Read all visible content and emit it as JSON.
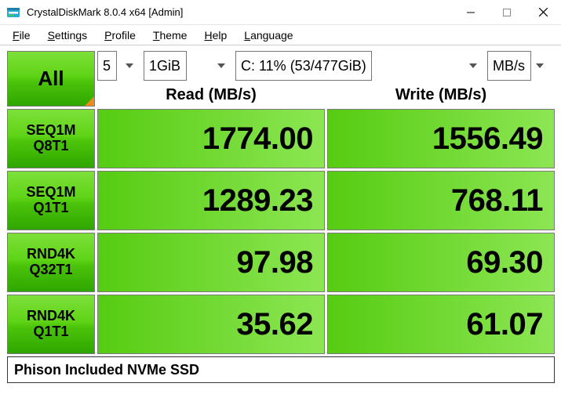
{
  "window": {
    "title": "CrystalDiskMark 8.0.4 x64 [Admin]"
  },
  "menu": {
    "file": "File",
    "settings": "Settings",
    "profile": "Profile",
    "theme": "Theme",
    "help": "Help",
    "language": "Language"
  },
  "controls": {
    "all_label": "All",
    "runs": "5",
    "size": "1GiB",
    "drive": "C: 11% (53/477GiB)",
    "unit": "MB/s"
  },
  "headers": {
    "read": "Read (MB/s)",
    "write": "Write (MB/s)"
  },
  "tests": [
    {
      "id": "seq1m-q8t1",
      "line1": "SEQ1M",
      "line2": "Q8T1",
      "read": "1774.00",
      "write": "1556.49"
    },
    {
      "id": "seq1m-q1t1",
      "line1": "SEQ1M",
      "line2": "Q1T1",
      "read": "1289.23",
      "write": "768.11"
    },
    {
      "id": "rnd4k-q32t1",
      "line1": "RND4K",
      "line2": "Q32T1",
      "read": "97.98",
      "write": "69.30"
    },
    {
      "id": "rnd4k-q1t1",
      "line1": "RND4K",
      "line2": "Q1T1",
      "read": "35.62",
      "write": "61.07"
    }
  ],
  "footer": "Phison Included NVMe SSD"
}
